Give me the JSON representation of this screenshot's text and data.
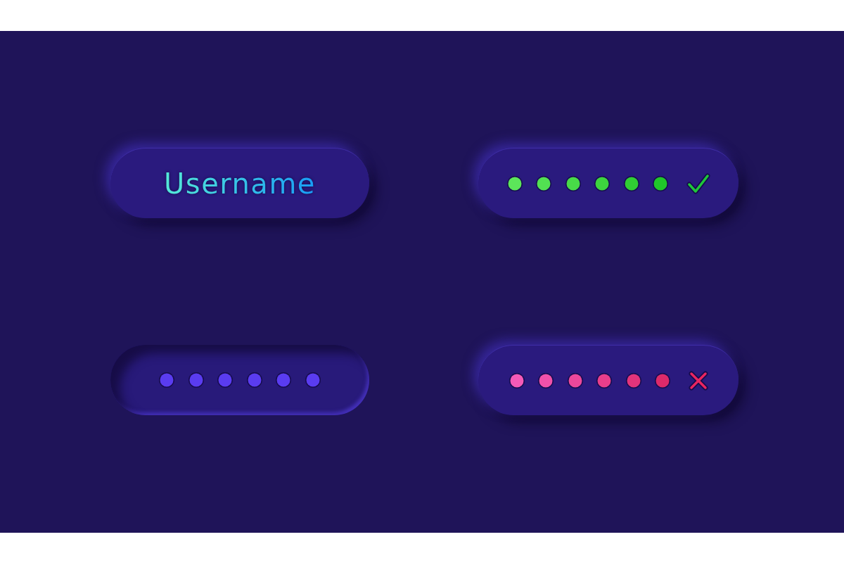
{
  "fields": [
    {
      "kind": "text",
      "pressed": false,
      "value": "Username"
    },
    {
      "kind": "password",
      "pressed": false,
      "valid": true,
      "dots": [
        {
          "color": "#5ce65a"
        },
        {
          "color": "#52e052"
        },
        {
          "color": "#48da48"
        },
        {
          "color": "#3dd43e"
        },
        {
          "color": "#30ce34"
        },
        {
          "color": "#20c62a"
        }
      ]
    },
    {
      "kind": "password",
      "pressed": true,
      "dots": [
        {
          "color": "#5a3cf0"
        },
        {
          "color": "#5a3cf0"
        },
        {
          "color": "#5a3cf0"
        },
        {
          "color": "#5a3cf0"
        },
        {
          "color": "#5a3cf0"
        },
        {
          "color": "#5a3cf0"
        }
      ]
    },
    {
      "kind": "password",
      "pressed": false,
      "valid": false,
      "dots": [
        {
          "color": "#f55ab8"
        },
        {
          "color": "#f151aa"
        },
        {
          "color": "#ec489b"
        },
        {
          "color": "#e83e8b"
        },
        {
          "color": "#e3347b"
        },
        {
          "color": "#dd2a6a"
        }
      ]
    }
  ]
}
